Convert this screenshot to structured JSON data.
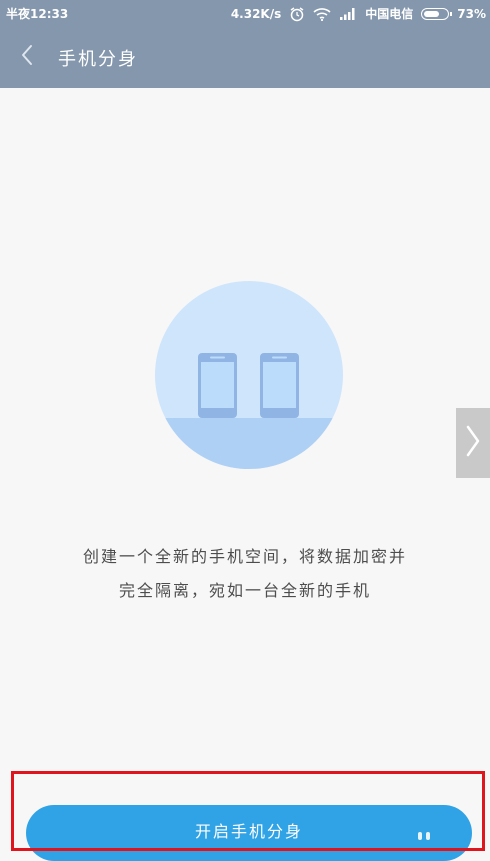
{
  "status_bar": {
    "time": "半夜12:33",
    "network_speed": "4.32K/s",
    "carrier": "中国电信",
    "battery": "73%",
    "battery_level": 0.73
  },
  "header": {
    "title": "手机分身"
  },
  "main": {
    "description_line1": "创建一个全新的手机空间，将数据加密并",
    "description_line2": "完全隔离，宛如一台全新的手机"
  },
  "action": {
    "button_label": "开启手机分身"
  },
  "colors": {
    "header_bg": "#8497ad",
    "accent": "#30a3e6",
    "illustration_circle": "#cfe5fc",
    "highlight_box": "#e0141c"
  }
}
